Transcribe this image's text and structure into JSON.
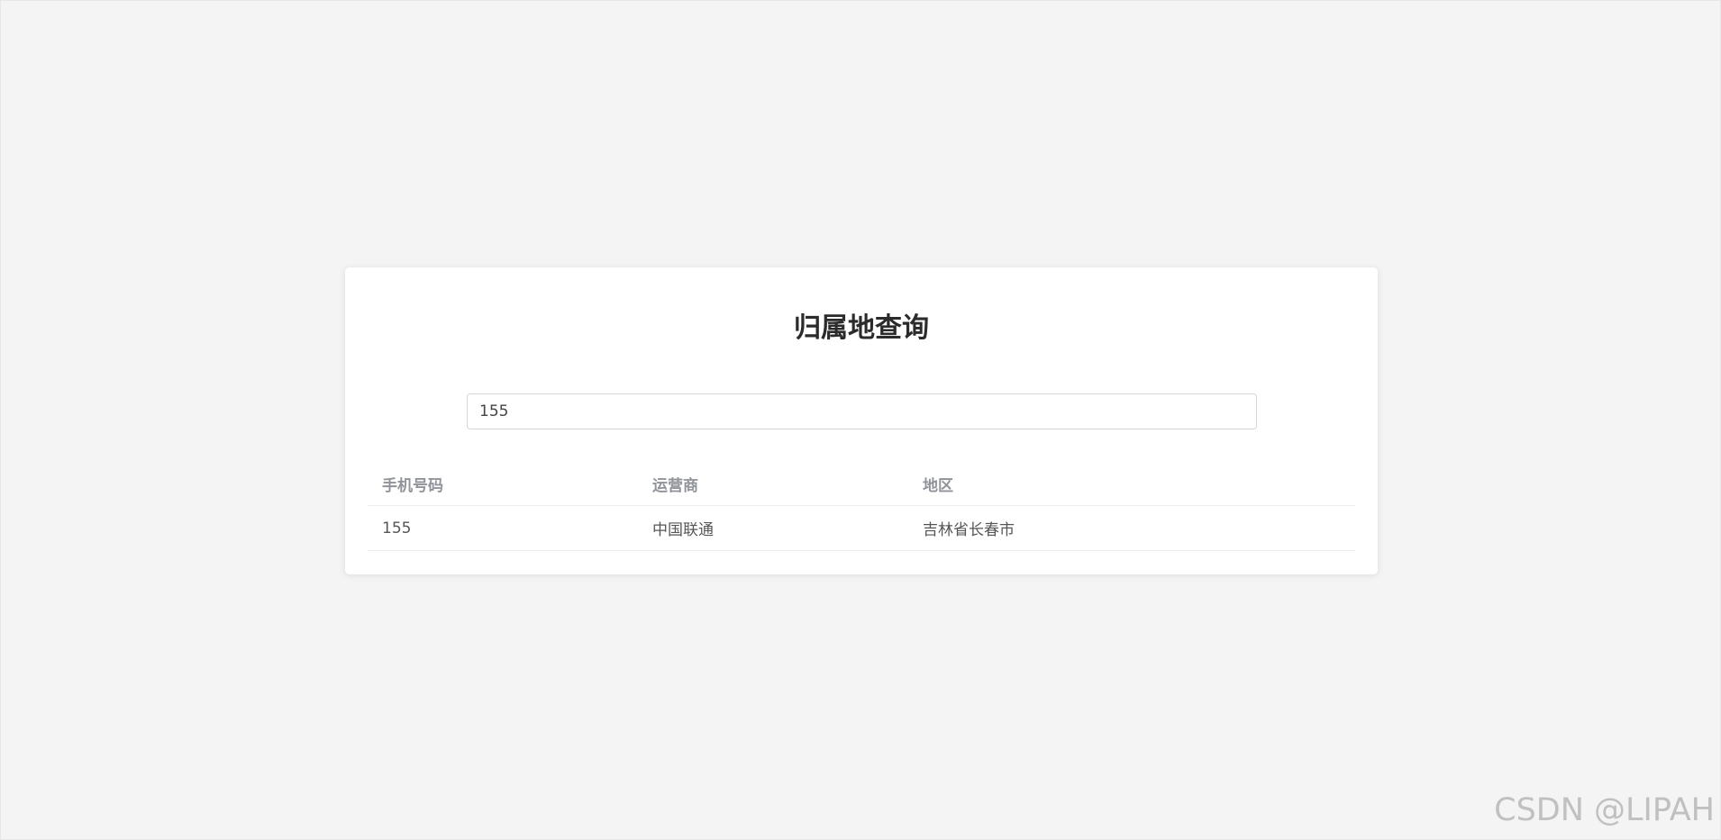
{
  "page": {
    "title": "归属地查询",
    "watermark": "CSDN @LIPAH"
  },
  "search": {
    "value": "155",
    "placeholder": ""
  },
  "table": {
    "headers": [
      "手机号码",
      "运营商",
      "地区"
    ],
    "rows": [
      [
        "155",
        "中国联通",
        "吉林省长春市"
      ]
    ]
  },
  "colors": {
    "background": "#f4f4f4",
    "card": "#ffffff",
    "title": "#2b2b2b",
    "header_text": "#909399",
    "cell_text": "#555555"
  }
}
